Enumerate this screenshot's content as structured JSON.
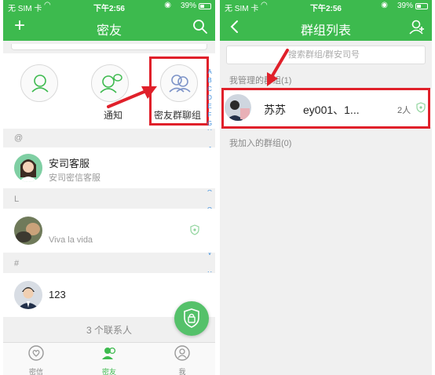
{
  "status": {
    "carrier": "无 SIM 卡",
    "time": "下午2:56",
    "battery": "39%"
  },
  "left": {
    "title": "密友",
    "functions": [
      {
        "label": ""
      },
      {
        "label": "通知"
      },
      {
        "label": "密友群聊组"
      }
    ],
    "alphabet": [
      "A",
      "B",
      "C",
      "D",
      "E",
      "F",
      "G",
      "H",
      "I",
      "J",
      "K",
      "L",
      "M",
      "N",
      "O",
      "P",
      "Q",
      "R",
      "S",
      "T",
      "U",
      "V",
      "W",
      "X",
      "Y",
      "Z",
      "#"
    ],
    "sections": [
      {
        "header": "@",
        "contacts": [
          {
            "name": "安司客服",
            "subtitle": "安司密信客服"
          }
        ]
      },
      {
        "header": "L",
        "contacts": [
          {
            "name": "",
            "subtitle": "Viva la vida"
          }
        ]
      },
      {
        "header": "#",
        "contacts": [
          {
            "name": "123",
            "subtitle": ""
          }
        ]
      }
    ],
    "contact_count": "3 个联系人",
    "tabs": [
      {
        "label": "密信"
      },
      {
        "label": "密友"
      },
      {
        "label": "我"
      }
    ]
  },
  "right": {
    "title": "群组列表",
    "search_placeholder": "搜索群组/群安司号",
    "managed_header": "我管理的群组(1)",
    "group": {
      "name": "苏苏",
      "members": "ey001、1...",
      "count": "2人"
    },
    "joined_header": "我加入的群组(0)"
  },
  "colors": {
    "brand_green": "#3dba4e",
    "highlight_red": "#e0202a",
    "index_blue": "#3a8ddd"
  }
}
